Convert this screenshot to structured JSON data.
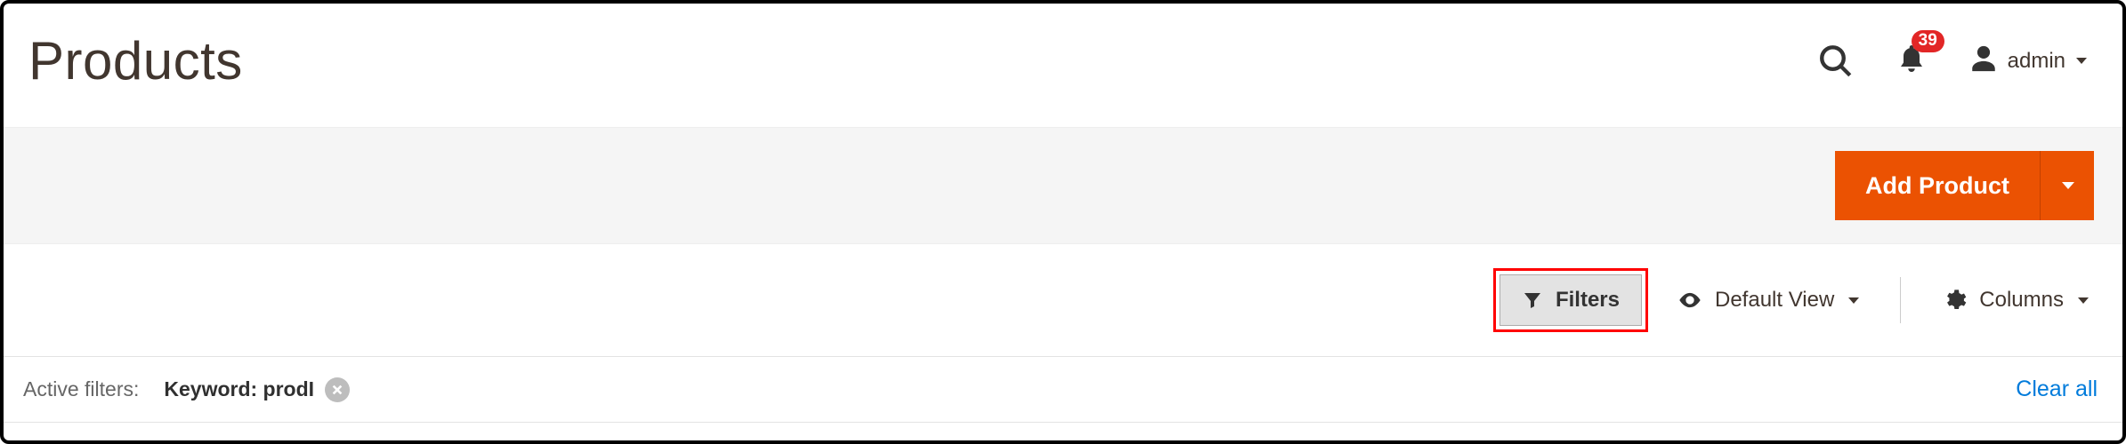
{
  "header": {
    "title": "Products",
    "notification_count": "39",
    "user": {
      "label": "admin"
    }
  },
  "actionbar": {
    "add_product_label": "Add Product"
  },
  "controls": {
    "filters_label": "Filters",
    "default_view_label": "Default View",
    "columns_label": "Columns"
  },
  "active_filters": {
    "label": "Active filters:",
    "chips": [
      {
        "label": "Keyword: prodI"
      }
    ],
    "clear_all_label": "Clear all"
  },
  "colors": {
    "primary": "#eb5202",
    "danger": "#e22626",
    "link": "#007bdb"
  }
}
